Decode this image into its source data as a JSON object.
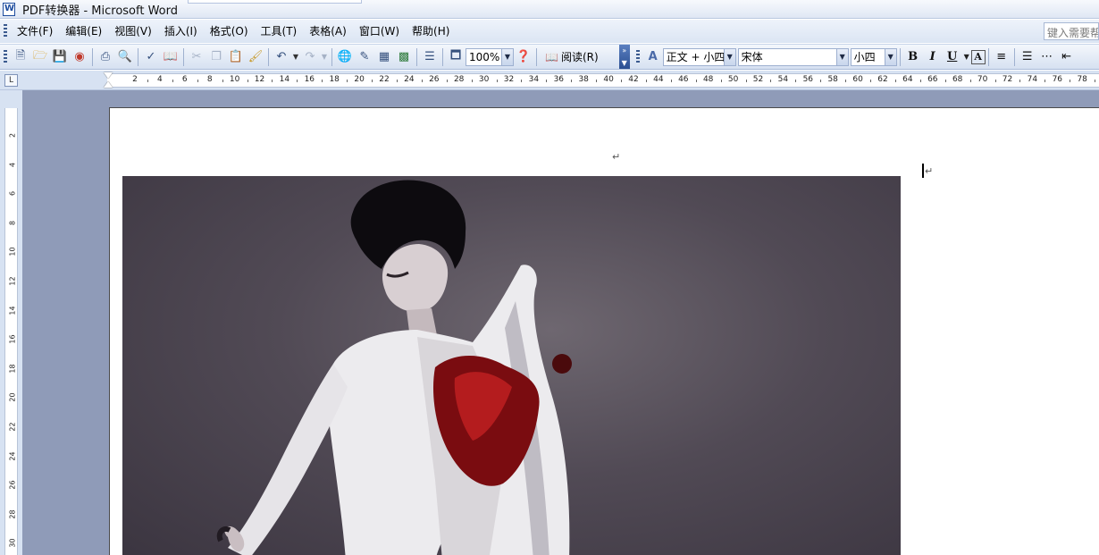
{
  "window": {
    "title": "PDF转换器 - Microsoft Word"
  },
  "menu": {
    "items": [
      "文件(F)",
      "编辑(E)",
      "视图(V)",
      "插入(I)",
      "格式(O)",
      "工具(T)",
      "表格(A)",
      "窗口(W)",
      "帮助(H)"
    ],
    "help_placeholder": "键入需要帮"
  },
  "toolbar": {
    "zoom": "100%",
    "read_label": "阅读(R)",
    "style": "正文 + 小四",
    "font": "宋体",
    "font_size": "小四",
    "bold": "B",
    "italic": "I",
    "underline": "U",
    "font_color": "A"
  },
  "ruler": {
    "horizontal": [
      "2",
      "4",
      "6",
      "8",
      "10",
      "12",
      "14",
      "16",
      "18",
      "20",
      "22",
      "24",
      "26",
      "28",
      "30",
      "32",
      "34",
      "36",
      "38",
      "40",
      "42",
      "44",
      "46",
      "48",
      "50",
      "52",
      "54",
      "56",
      "58",
      "60",
      "62",
      "64",
      "66",
      "68",
      "70",
      "72",
      "74",
      "76",
      "78"
    ],
    "vertical": [
      "2",
      "4",
      "6",
      "8",
      "10",
      "12",
      "14",
      "16",
      "18",
      "20",
      "22",
      "24",
      "26",
      "28",
      "30"
    ],
    "corner": "L"
  },
  "document": {
    "paragraph_mark": "↵"
  },
  "colors": {
    "workspace": "#8f9bb8",
    "toolbar": "#dbe5f3",
    "ruler_bg": "#d7e2f2"
  }
}
